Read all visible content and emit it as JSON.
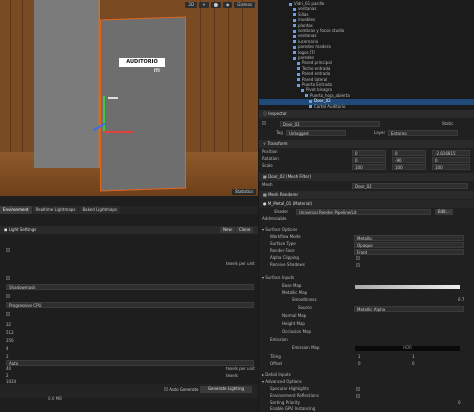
{
  "scene": {
    "door_sign": "AUDITORIO",
    "door_sign_sub": "ITI",
    "tools": [
      "2D",
      "☀",
      "⬤",
      "◆",
      "Gizmos"
    ],
    "stats_label": "Statistics"
  },
  "hierarchy": {
    "rows": [
      {
        "label": "Vidri_01 pasillo",
        "indent": 30
      },
      {
        "label": "ventanas",
        "indent": 34
      },
      {
        "label": "Sillas",
        "indent": 34
      },
      {
        "label": "muebles",
        "indent": 34
      },
      {
        "label": "plantas",
        "indent": 34
      },
      {
        "label": "sombras y focos studio",
        "indent": 34
      },
      {
        "label": "ventanas",
        "indent": 34
      },
      {
        "label": "lucernario",
        "indent": 34
      },
      {
        "label": "paredes madera",
        "indent": 34
      },
      {
        "label": "logos ITI",
        "indent": 34
      },
      {
        "label": "paredes",
        "indent": 34
      },
      {
        "label": "Pared principal",
        "indent": 38
      },
      {
        "label": "Techo entrada",
        "indent": 38
      },
      {
        "label": "Pared entrada",
        "indent": 38
      },
      {
        "label": "Pared lateral",
        "indent": 38
      },
      {
        "label": "Puerta Entrada",
        "indent": 38
      },
      {
        "label": "Pivot bisagra",
        "indent": 42
      },
      {
        "label": "Puerta_hoja_abierta",
        "indent": 46
      },
      {
        "label": "Door_02",
        "indent": 50,
        "selected": true
      },
      {
        "label": "Cartel Auditorio",
        "indent": 50
      }
    ]
  },
  "inspector": {
    "tab": "Inspector",
    "object_name": "Door_02",
    "static_label": "Static",
    "tag_label": "Tag",
    "tag_value": "Untagged",
    "layer_label": "Layer",
    "layer_value": "Entorno",
    "transform_label": "Transform",
    "position_label": "Position",
    "rotation_label": "Rotation",
    "scale_label": "Scale",
    "pos": {
      "x": "0",
      "y": "0",
      "z": "-2.816815"
    },
    "rot": {
      "x": "0",
      "y": "-90",
      "z": "0"
    },
    "scale": {
      "x": "100",
      "y": "100",
      "z": "100"
    },
    "mesh_filter_label": "Door_02 (Mesh Filter)",
    "mesh_label": "Mesh",
    "mesh_value": "Door_02",
    "mesh_renderer_label": "Mesh Renderer",
    "material_label": "M_Metal_01 (Material)",
    "shader_label": "Shader",
    "shader_value": "Universal Render Pipeline/Lit",
    "edit_label": "Edit...",
    "addressable_label": "Addressable",
    "surface_options": "Surface Options",
    "workflow_label": "Workflow Mode",
    "workflow_value": "Metallic",
    "surface_type_label": "Surface Type",
    "surface_type_value": "Opaque",
    "render_face_label": "Render Face",
    "render_face_value": "Front",
    "alpha_clip_label": "Alpha Clipping",
    "receive_shadows_label": "Receive Shadows",
    "surface_inputs": "Surface Inputs",
    "base_map_label": "Base Map",
    "metallic_map_label": "Metallic Map",
    "smoothness_label": "Smoothness",
    "smoothness_value": "0.7",
    "source_label": "Source",
    "source_value": "Metallic Alpha",
    "normal_map_label": "Normal Map",
    "height_map_label": "Height Map",
    "occlusion_map_label": "Occlusion Map",
    "emission_label": "Emission",
    "emission_map_label": "Emission Map",
    "hdr_label": "HDR",
    "tiling_label": "Tiling",
    "offset_label": "Offset",
    "tiling": {
      "x": "1",
      "y": "1"
    },
    "offset": {
      "x": "0",
      "y": "0"
    },
    "detail_inputs": "Detail Inputs",
    "advanced_options": "Advanced Options",
    "specular_label": "Specular Highlights",
    "env_reflections_label": "Environment Reflections",
    "sorting_label": "Sorting Priority",
    "sorting_value": "0",
    "gpu_inst_label": "Enable GPU Instancing"
  },
  "lighting": {
    "tabs": [
      "Environment",
      "Realtime Lightmaps",
      "Baked Lightmaps"
    ],
    "active_tab": 0,
    "settings_label": "Light Settings",
    "new_label": "New",
    "clone_label": "Clone",
    "texels_label": "texels per unit",
    "shadowmask_value": "Shadowmask",
    "progressive_value": "Progressive CPU",
    "values": [
      "32",
      "512",
      "256",
      "4",
      "2"
    ],
    "auto_value": "Auto",
    "v40": "40",
    "v2": "2",
    "v1024": "1024",
    "texels_label_2": "texels per unit",
    "texels_label_3": "texels",
    "auto_generate_label": "Auto Generate",
    "generate_label": "Generate Lighting",
    "mb_label": "0.0 MB"
  }
}
